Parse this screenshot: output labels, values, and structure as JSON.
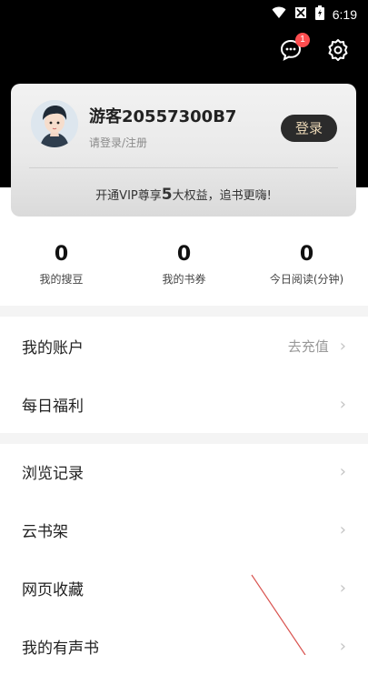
{
  "status_bar": {
    "time": "6:19",
    "icons": [
      "wifi-icon",
      "signal-off-icon",
      "battery-icon"
    ]
  },
  "header": {
    "message_badge": "1",
    "icons": [
      "message-icon",
      "settings-icon"
    ]
  },
  "profile": {
    "username": "游客20557300B7",
    "login_prompt": "请登录/注册",
    "login_button": "登录",
    "vip_prefix": "开通VIP尊享",
    "vip_number": "5",
    "vip_suffix": "大权益，追书更嗨!"
  },
  "stats": [
    {
      "value": "0",
      "label": "我的搜豆"
    },
    {
      "value": "0",
      "label": "我的书券"
    },
    {
      "value": "0",
      "label": "今日阅读(分钟)"
    }
  ],
  "menu_group_1": [
    {
      "label": "我的账户",
      "action_text": "去充值"
    },
    {
      "label": "每日福利",
      "action_text": ""
    }
  ],
  "menu_group_2": [
    {
      "label": "浏览记录"
    },
    {
      "label": "云书架"
    },
    {
      "label": "网页收藏"
    },
    {
      "label": "我的有声书"
    }
  ],
  "colors": {
    "black": "#000000",
    "login_text": "#e9d6b5",
    "badge": "#ff4d4f",
    "annotation_line": "#d9534f"
  }
}
